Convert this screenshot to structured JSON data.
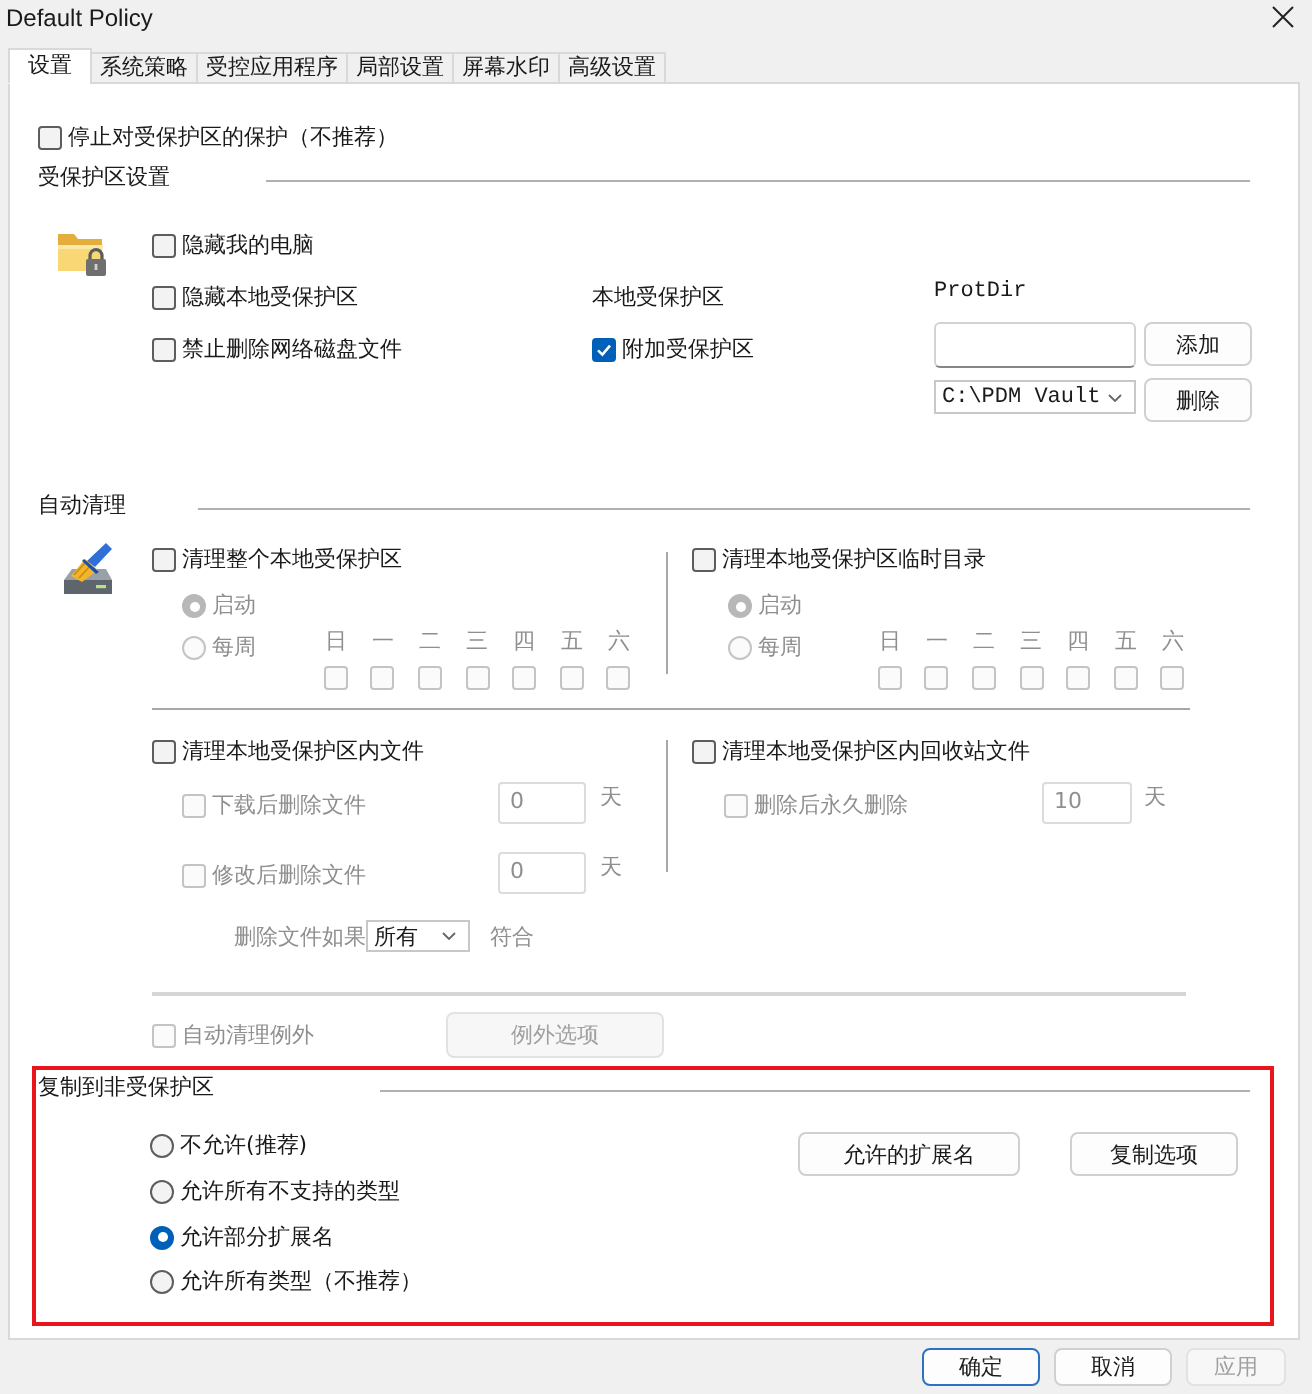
{
  "window": {
    "title": "Default Policy"
  },
  "tabs": [
    {
      "label": "设置",
      "selected": true
    },
    {
      "label": "系统策略",
      "selected": false
    },
    {
      "label": "受控应用程序",
      "selected": false
    },
    {
      "label": "局部设置",
      "selected": false
    },
    {
      "label": "屏幕水印",
      "selected": false
    },
    {
      "label": "高级设置",
      "selected": false
    }
  ],
  "stop_protection": {
    "label": "停止对受保护区的保护（不推荐）",
    "checked": false
  },
  "protected_area": {
    "title": "受保护区设置",
    "options": [
      {
        "label": "隐藏我的电脑",
        "checked": false
      },
      {
        "label": "隐藏本地受保护区",
        "checked": false
      },
      {
        "label": "禁止删除网络磁盘文件",
        "checked": false
      }
    ],
    "local_area_label": "本地受保护区",
    "attach": {
      "label": "附加受保护区",
      "checked": true
    },
    "protdir": {
      "label": "ProtDir",
      "add_button": "添加",
      "path_dropdown": {
        "value": "C:\\PDM Vault"
      },
      "delete_button": "删除"
    }
  },
  "auto_cleanup": {
    "title": "自动清理",
    "schedules": [
      {
        "label": "清理整个本地受保护区",
        "checked": false,
        "modes": [
          {
            "label": "启动",
            "selected": true,
            "disabled": true
          },
          {
            "label": "每周",
            "selected": false,
            "disabled": true
          }
        ],
        "days": [
          {
            "label": "日",
            "checked": false,
            "disabled": true
          },
          {
            "label": "一",
            "checked": false,
            "disabled": true
          },
          {
            "label": "二",
            "checked": false,
            "disabled": true
          },
          {
            "label": "三",
            "checked": false,
            "disabled": true
          },
          {
            "label": "四",
            "checked": false,
            "disabled": true
          },
          {
            "label": "五",
            "checked": false,
            "disabled": true
          },
          {
            "label": "六",
            "checked": false,
            "disabled": true
          }
        ]
      },
      {
        "label": "清理本地受保护区临时目录",
        "checked": false,
        "modes": [
          {
            "label": "启动",
            "selected": true,
            "disabled": true
          },
          {
            "label": "每周",
            "selected": false,
            "disabled": true
          }
        ],
        "days": [
          {
            "label": "日",
            "checked": false,
            "disabled": true
          },
          {
            "label": "一",
            "checked": false,
            "disabled": true
          },
          {
            "label": "二",
            "checked": false,
            "disabled": true
          },
          {
            "label": "三",
            "checked": false,
            "disabled": true
          },
          {
            "label": "四",
            "checked": false,
            "disabled": true
          },
          {
            "label": "五",
            "checked": false,
            "disabled": true
          },
          {
            "label": "六",
            "checked": false,
            "disabled": true
          }
        ]
      }
    ],
    "file_cleanups": [
      {
        "label": "清理本地受保护区内文件",
        "checked": false,
        "rules": [
          {
            "label": "下载后删除文件",
            "checked": false,
            "disabled": true,
            "value": "0",
            "unit": "天"
          },
          {
            "label": "修改后删除文件",
            "checked": false,
            "disabled": true,
            "value": "0",
            "unit": "天"
          }
        ],
        "condition": {
          "label": "删除文件如果",
          "value": "所有",
          "suffix": "符合",
          "disabled": true
        }
      },
      {
        "label": "清理本地受保护区内回收站文件",
        "checked": false,
        "rules": [
          {
            "label": "删除后永久删除",
            "checked": false,
            "disabled": true,
            "value": "10",
            "unit": "天"
          }
        ]
      }
    ],
    "exceptions": {
      "label": "自动清理例外",
      "checked": false,
      "disabled": true
    },
    "exceptions_button": {
      "label": "例外选项",
      "disabled": true
    }
  },
  "copy_section": {
    "title": "复制到非受保护区",
    "highlighted": true,
    "options": [
      {
        "label": "不允许(推荐)",
        "selected": false
      },
      {
        "label": "允许所有不支持的类型",
        "selected": false
      },
      {
        "label": "允许部分扩展名",
        "selected": true
      },
      {
        "label": "允许所有类型（不推荐）",
        "selected": false
      }
    ],
    "buttons": [
      {
        "label": "允许的扩展名"
      },
      {
        "label": "复制选项"
      }
    ]
  },
  "footer_buttons": [
    {
      "label": "确定",
      "default": true,
      "disabled": false
    },
    {
      "label": "取消",
      "default": false,
      "disabled": false
    },
    {
      "label": "应用",
      "default": false,
      "disabled": true
    }
  ]
}
